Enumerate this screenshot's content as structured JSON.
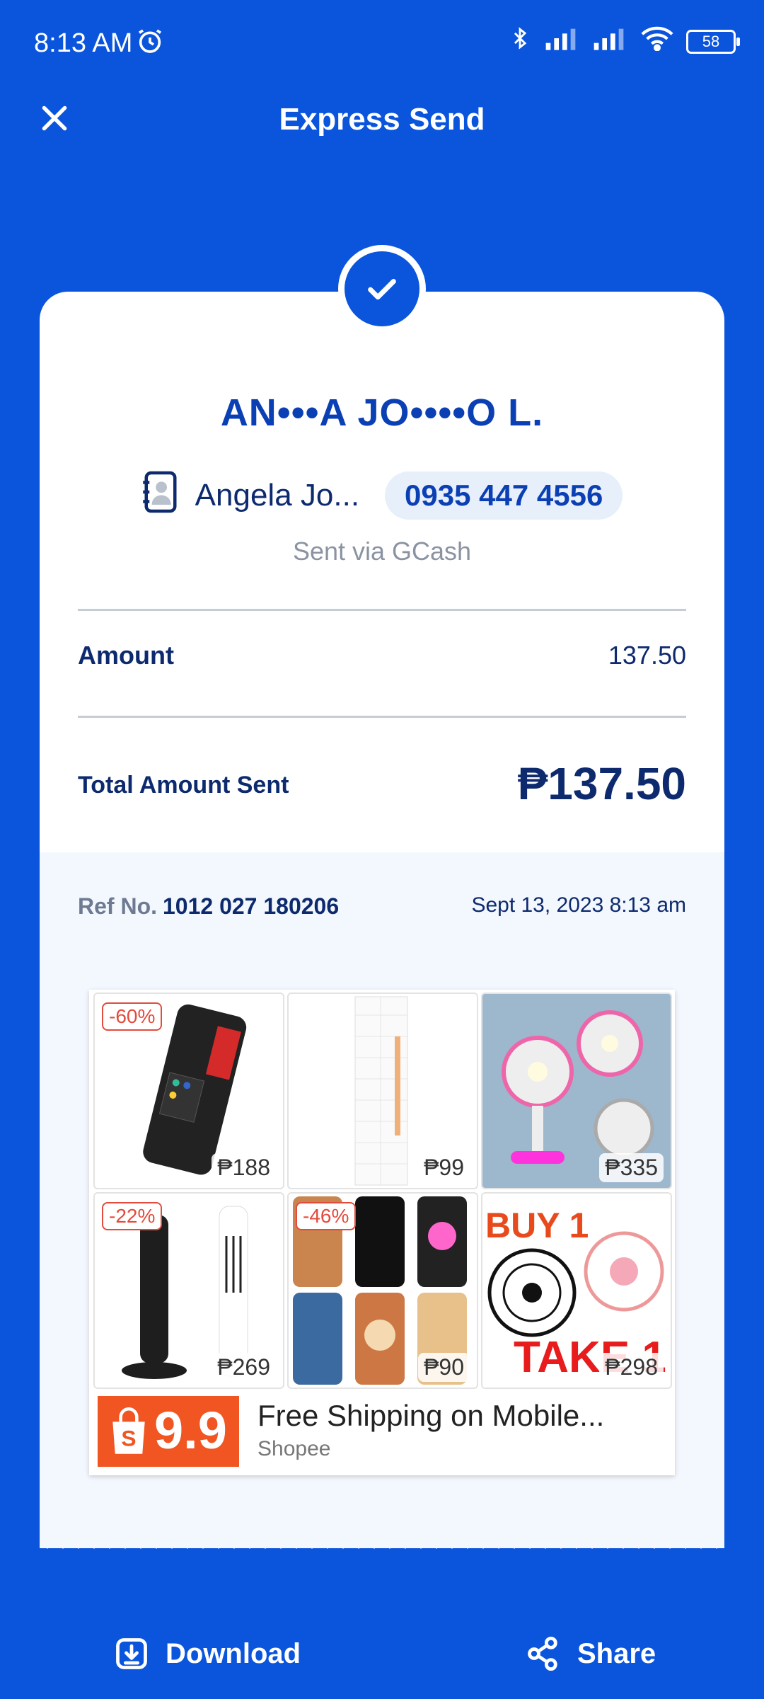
{
  "status_bar": {
    "time": "8:13 AM",
    "battery": "58"
  },
  "header": {
    "title": "Express Send"
  },
  "receipt": {
    "masked_name": "AN•••A JO••••O L.",
    "contact_name": "Angela Jo...",
    "number": "0935 447 4556",
    "sent_via": "Sent via GCash",
    "amount_label": "Amount",
    "amount_value": "137.50",
    "total_label": "Total Amount Sent",
    "total_value": "₱137.50",
    "ref_label": "Ref No.",
    "ref_number": "1012 027 180206",
    "date": "Sept 13, 2023 8:13 am"
  },
  "ad": {
    "tiles": [
      {
        "discount": "-60%",
        "price": "₱188"
      },
      {
        "discount": "",
        "price": "₱99"
      },
      {
        "discount": "",
        "price": "₱335"
      },
      {
        "discount": "-22%",
        "price": "₱269"
      },
      {
        "discount": "-46%",
        "price": "₱90"
      },
      {
        "discount": "",
        "price": "₱298"
      }
    ],
    "promo_text_1": "BUY 1",
    "promo_text_2": "TAKE 1",
    "logo_text": "9.9",
    "headline": "Free Shipping on Mobile...",
    "brand": "Shopee"
  },
  "actions": {
    "download": "Download",
    "share": "Share"
  },
  "colors": {
    "brand_blue": "#0b55dc",
    "navy": "#0d2a6e",
    "discount_red": "#e34b3c",
    "shopee_orange": "#f05522"
  }
}
